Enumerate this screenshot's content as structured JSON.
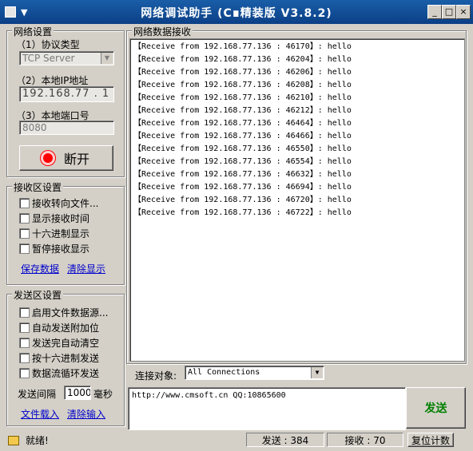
{
  "window": {
    "title": "网络调试助手 (C∎精装版 V3.8.2)",
    "menu_icon": "window-menu-icon"
  },
  "network_settings": {
    "group_title": "网络设置",
    "protocol_label": "（1）协议类型",
    "protocol_value": "TCP Server",
    "ip_label": "（2）本地IP地址",
    "ip_value": "192.168.77 . 1",
    "port_label": "（3）本地端口号",
    "port_value": "8080",
    "disconnect_label": "断开"
  },
  "receive_settings": {
    "group_title": "接收区设置",
    "options": [
      "接收转向文件...",
      "显示接收时间",
      "十六进制显示",
      "暂停接收显示"
    ],
    "save_link": "保存数据",
    "clear_link": "清除显示"
  },
  "send_settings": {
    "group_title": "发送区设置",
    "options": [
      "启用文件数据源...",
      "自动发送附加位",
      "发送完自动清空",
      "按十六进制发送",
      "数据流循环发送"
    ],
    "interval_label": "发送间隔",
    "interval_value": "1000",
    "interval_unit": "毫秒",
    "load_file_link": "文件载入",
    "clear_input_link": "清除输入"
  },
  "receive_area": {
    "title": "网络数据接收",
    "lines": [
      "【Receive from 192.168.77.136 : 46170】: hello",
      "【Receive from 192.168.77.136 : 46204】: hello",
      "【Receive from 192.168.77.136 : 46206】: hello",
      "【Receive from 192.168.77.136 : 46208】: hello",
      "【Receive from 192.168.77.136 : 46210】: hello",
      "【Receive from 192.168.77.136 : 46212】: hello",
      "【Receive from 192.168.77.136 : 46464】: hello",
      "【Receive from 192.168.77.136 : 46466】: hello",
      "【Receive from 192.168.77.136 : 46550】: hello",
      "【Receive from 192.168.77.136 : 46554】: hello",
      "【Receive from 192.168.77.136 : 46632】: hello",
      "【Receive from 192.168.77.136 : 46694】: hello",
      "【Receive from 192.168.77.136 : 46720】: hello",
      "【Receive from 192.168.77.136 : 46722】: hello"
    ]
  },
  "connection": {
    "label": "连接对象:",
    "value": "All Connections"
  },
  "send_area": {
    "text": "http://www.cmsoft.cn QQ:10865600",
    "send_label": "发送"
  },
  "status": {
    "ready": "就绪!",
    "sent": "发送 : 384",
    "received": "接收 : 70",
    "reset": "复位计数"
  },
  "colors": {
    "title_bar": "#0b3f86",
    "send_button_text": "#008000",
    "disconnect_led": "#ff0000",
    "link": "#0000cc"
  }
}
